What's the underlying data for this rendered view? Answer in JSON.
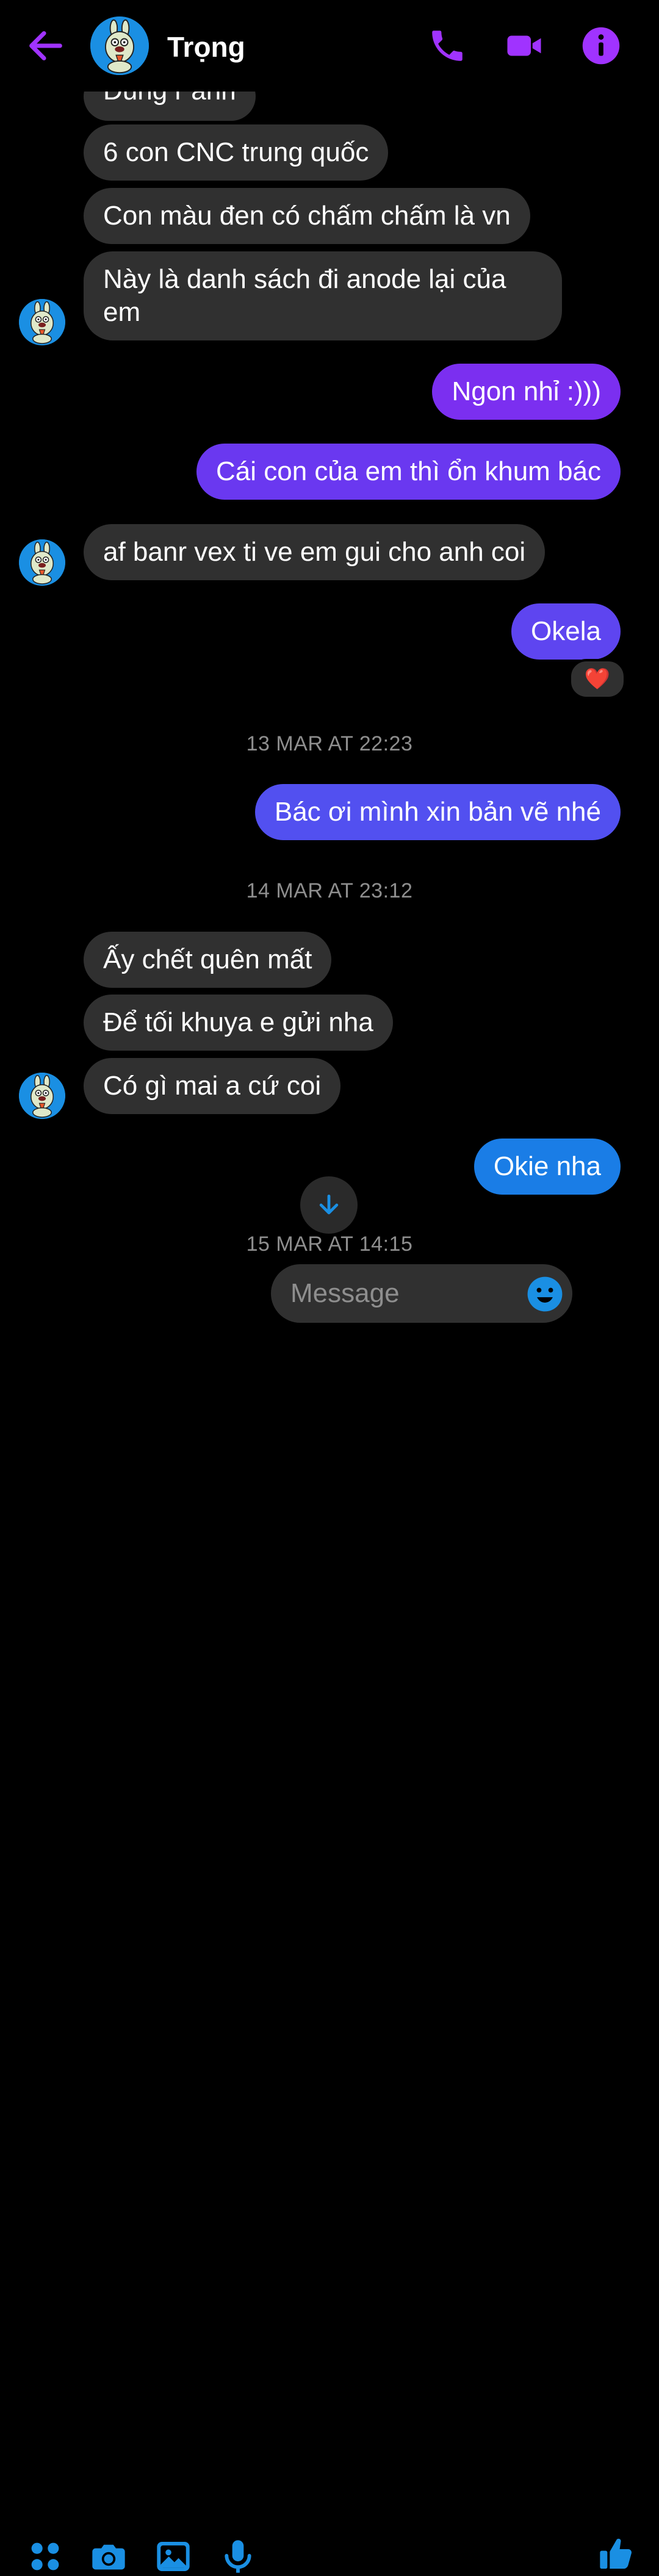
{
  "header": {
    "contact_name": "Trọng"
  },
  "messages": {
    "m0": "Đúng r anh",
    "m1": "6 con CNC trung quốc",
    "m2": "Con màu đen có chấm chấm là vn",
    "m3": "Này là danh sách đi anode lại của em",
    "m4": "Ngon nhỉ :)))",
    "m5": "Cái con của em thì ổn khum bác",
    "m6": "af banr vex ti ve em gui cho anh coi",
    "m7": "Okela",
    "m8": "Bác ơi mình xin bản vẽ nhé",
    "m9": "Ấy chết quên mất",
    "m10": "Để tối khuya e gửi nha",
    "m11": "Có gì mai a cứ coi",
    "m12": "Okie nha"
  },
  "timestamps": {
    "t1": "13 MAR AT 22:23",
    "t2": "14 MAR AT 23:12",
    "t3": "15 MAR AT 14:15"
  },
  "reaction": {
    "emoji": "❤️"
  },
  "composer": {
    "placeholder": "Message"
  },
  "colors": {
    "accent": "#a033ff",
    "incoming_bubble": "#303030",
    "outgoing_purple": "#7b2ff0",
    "outgoing_indigo": "#5a4bf0",
    "outgoing_blue": "#1a7de6",
    "composer_icon": "#1a8fe3",
    "background": "#000000"
  },
  "icons": [
    "back-arrow-icon",
    "phone-icon",
    "video-camera-icon",
    "info-icon",
    "chevron-down-icon",
    "apps-grid-icon",
    "camera-icon",
    "image-icon",
    "microphone-icon",
    "emoji-icon",
    "thumbs-up-icon"
  ]
}
